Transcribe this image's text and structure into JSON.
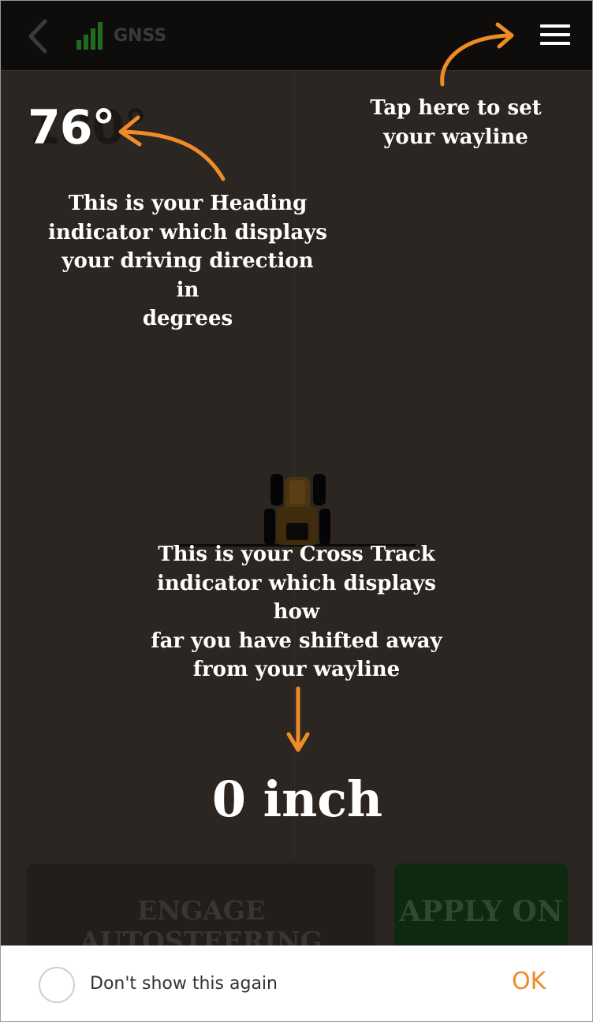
{
  "header": {
    "status_label": "GNSS",
    "icons": {
      "back": "chevron-left-icon",
      "signal": "signal-bars-icon",
      "menu": "hamburger-menu-icon"
    }
  },
  "heading": {
    "value": "76°",
    "ghost_value": "180°"
  },
  "tips": {
    "wayline": [
      "Tap here to set",
      "your wayline"
    ],
    "heading": [
      "This is your Heading",
      "indicator which displays",
      "your driving direction in",
      "degrees"
    ],
    "cross_track": [
      "This is your Cross Track",
      "indicator which displays how",
      "far you have shifted away",
      "from your wayline"
    ]
  },
  "cross_track": {
    "value": "0 inch"
  },
  "actions": {
    "engage_label": "ENGAGE AUTOSTEERING",
    "apply_label": "APPLY ON"
  },
  "footer": {
    "checkbox_label": "Don't show this again",
    "checkbox_checked": false,
    "ok_label": "OK"
  },
  "colors": {
    "accent": "#f08c28",
    "background": "#2c2622",
    "topbar": "#0f0d0c",
    "signal": "#1f6b1f",
    "apply_bg": "#0f2810"
  }
}
